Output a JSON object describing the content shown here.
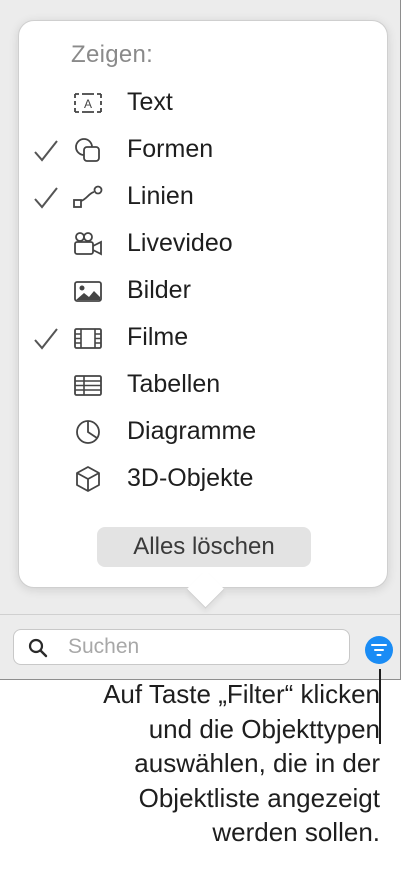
{
  "popover": {
    "heading": "Zeigen:",
    "items": [
      {
        "label": "Text",
        "checked": false,
        "icon": "text-box-icon"
      },
      {
        "label": "Formen",
        "checked": true,
        "icon": "shapes-icon"
      },
      {
        "label": "Linien",
        "checked": true,
        "icon": "lines-icon"
      },
      {
        "label": "Livevideo",
        "checked": false,
        "icon": "live-video-icon"
      },
      {
        "label": "Bilder",
        "checked": false,
        "icon": "image-icon"
      },
      {
        "label": "Filme",
        "checked": true,
        "icon": "film-icon"
      },
      {
        "label": "Tabellen",
        "checked": false,
        "icon": "table-icon"
      },
      {
        "label": "Diagramme",
        "checked": false,
        "icon": "pie-chart-icon"
      },
      {
        "label": "3D-Objekte",
        "checked": false,
        "icon": "cube-icon"
      }
    ],
    "clear_label": "Alles löschen"
  },
  "search": {
    "placeholder": "Suchen",
    "value": ""
  },
  "filter_button": {
    "icon": "filter-icon",
    "color": "#1a8cf5"
  },
  "callout": {
    "lines": [
      "Auf Taste „Filter“ klicken",
      "und die Objekttypen",
      "auswählen, die in der",
      "Objektliste angezeigt",
      "werden sollen."
    ]
  }
}
